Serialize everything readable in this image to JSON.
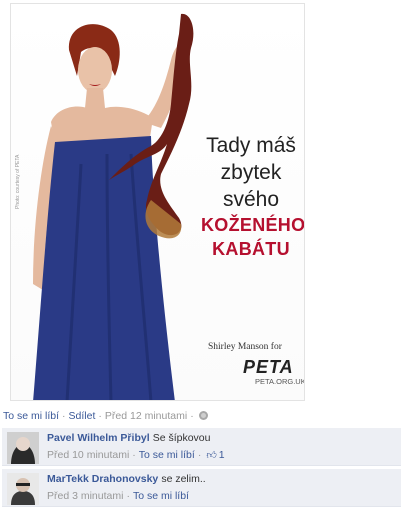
{
  "poster": {
    "line1": "Tady máš",
    "line2": "zbytek",
    "line3": "svého",
    "red1": "KOŽENÉHO",
    "red2": "KABÁTU",
    "credit": "Shirley Manson for",
    "org_logo": "PETA",
    "url": "PETA.ORG.UK",
    "colors": {
      "accent_red": "#b5102f",
      "dress_blue": "#2a3a86",
      "hair_red": "#8a2a16"
    }
  },
  "actions": {
    "like": "To se mi líbí",
    "share": "Sdílet",
    "separator": "·",
    "time": "Před 12 minutami",
    "privacy_icon": "globe-icon"
  },
  "comments": [
    {
      "author": "Pavel Wilhelm Přibyl",
      "text": "Se šípkovou",
      "time": "Před 10 minutami",
      "like": "To se mi líbí",
      "like_icon": "thumbs-up-icon",
      "like_count": "1"
    },
    {
      "author": "MarTekk Drahonovsky",
      "text": "se zelim..",
      "time": "Před 3 minutami",
      "like": "To se mi líbí"
    }
  ],
  "colors": {
    "link": "#3b5998",
    "comment_bg": "#edeff4",
    "muted": "#999999"
  }
}
